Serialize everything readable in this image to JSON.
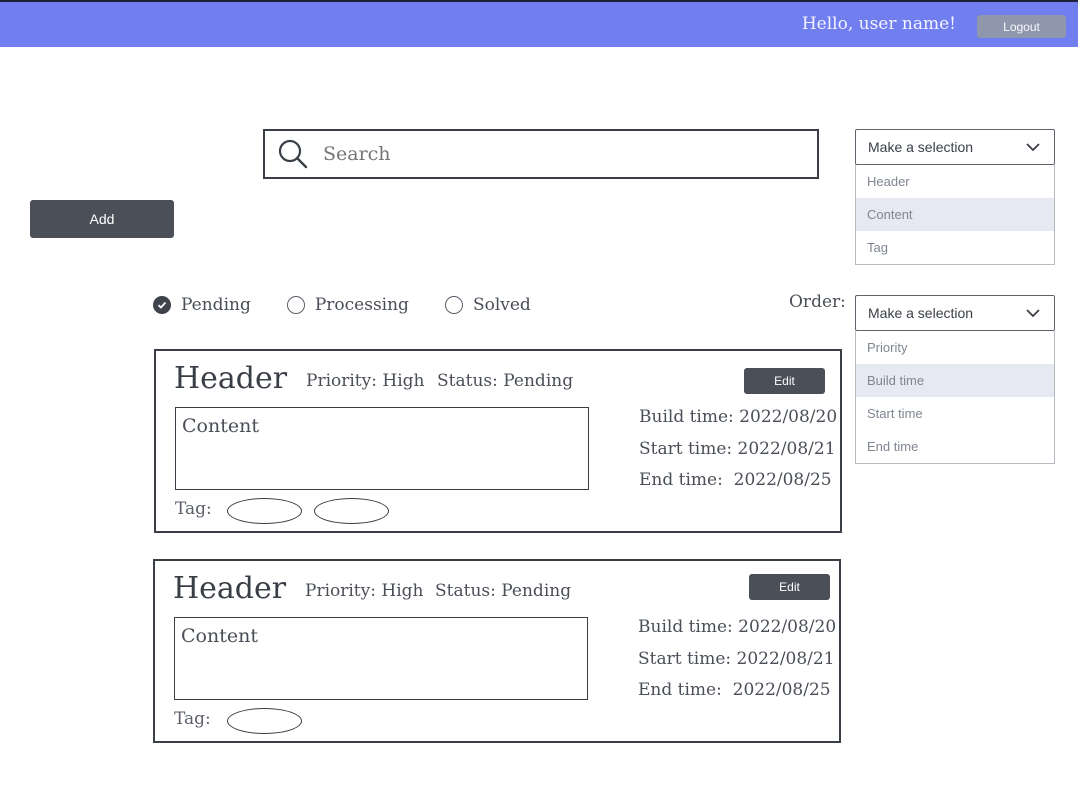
{
  "topbar": {
    "greeting": "Hello, user name!",
    "logout_label": "Logout",
    "bg_color": "#717ef0"
  },
  "search": {
    "placeholder": "Search",
    "icon": "search-icon"
  },
  "add_label": "Add",
  "search_field_dropdown": {
    "selected": "Make a selection",
    "options": [
      "Header",
      "Content",
      "Tag"
    ],
    "highlighted": "Content"
  },
  "status_filter": {
    "options": [
      "Pending",
      "Processing",
      "Solved"
    ],
    "selected": "Pending"
  },
  "order": {
    "label": "Order:",
    "selected": "Make a selection",
    "options": [
      "Priority",
      "Build time",
      "Start time",
      "End time"
    ],
    "highlighted": "Build time"
  },
  "cards": [
    {
      "header": "Header",
      "priority": "Priority: High",
      "status": "Status: Pending",
      "edit_label": "Edit",
      "content": "Content",
      "build_time": "Build time: 2022/08/20",
      "start_time": "Start time: 2022/08/21",
      "end_time": "End time:  2022/08/25",
      "tag_label": "Tag:",
      "tag_count": 2
    },
    {
      "header": "Header",
      "priority": "Priority: High",
      "status": "Status: Pending",
      "edit_label": "Edit",
      "content": "Content",
      "build_time": "Build time: 2022/08/20",
      "start_time": "Start time: 2022/08/21",
      "end_time": "End time:  2022/08/25",
      "tag_label": "Tag:",
      "tag_count": 1
    }
  ]
}
